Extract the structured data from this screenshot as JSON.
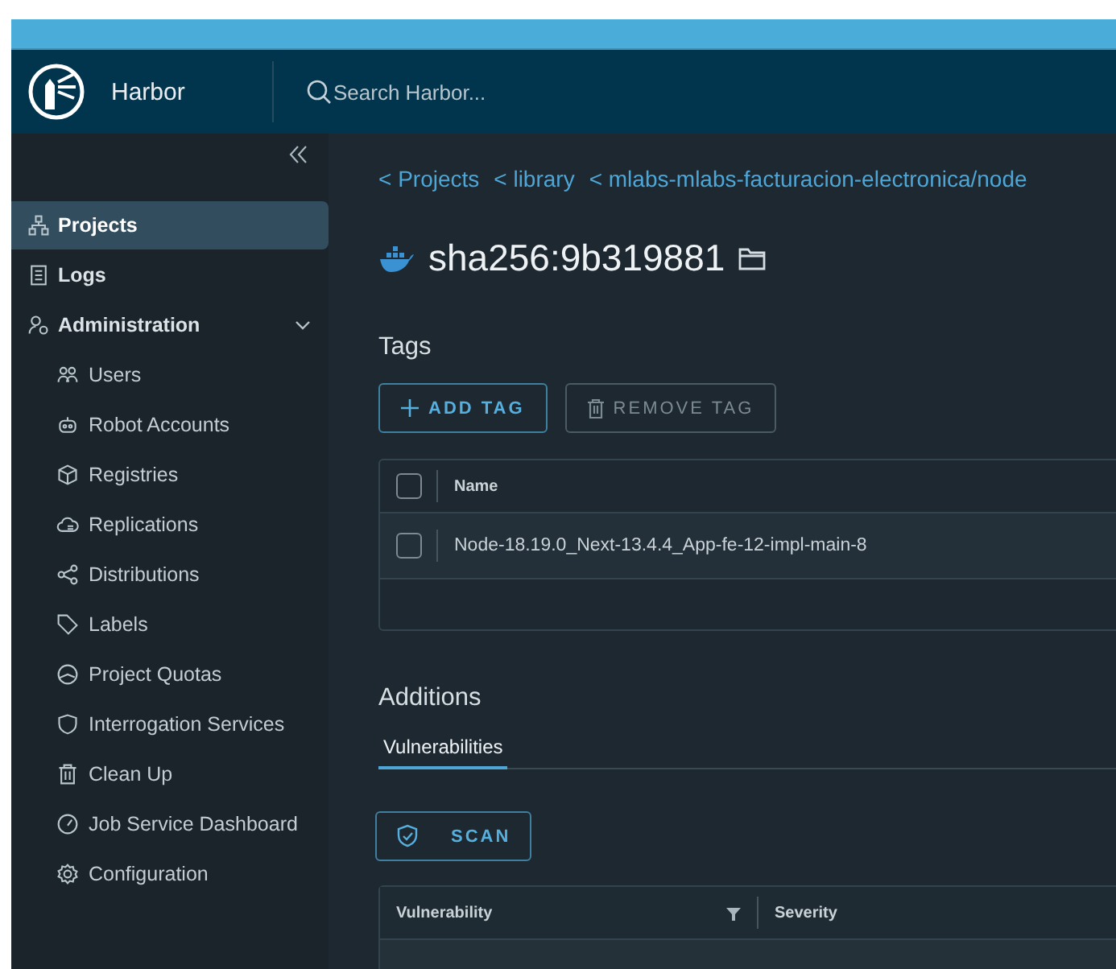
{
  "header": {
    "app_name": "Harbor",
    "search": {
      "placeholder": "Search Harbor..."
    }
  },
  "sidebar": {
    "items": [
      {
        "label": "Projects",
        "selected": true
      },
      {
        "label": "Logs",
        "selected": false
      },
      {
        "label": "Administration",
        "selected": false,
        "expanded": true,
        "children": [
          {
            "label": "Users",
            "selected": false
          },
          {
            "label": "Robot Accounts",
            "selected": false
          },
          {
            "label": "Registries",
            "selected": false
          },
          {
            "label": "Replications",
            "selected": false
          },
          {
            "label": "Distributions",
            "selected": false
          },
          {
            "label": "Labels",
            "selected": false
          },
          {
            "label": "Project Quotas",
            "selected": false
          },
          {
            "label": "Interrogation Services",
            "selected": false
          },
          {
            "label": "Clean Up",
            "selected": false
          },
          {
            "label": "Job Service Dashboard",
            "selected": false
          },
          {
            "label": "Configuration",
            "selected": false
          }
        ]
      }
    ]
  },
  "breadcrumbs": [
    "< Projects",
    "< library",
    "< mlabs-mlabs-facturacion-electronica/node"
  ],
  "artifact": {
    "title": "sha256:9b319881"
  },
  "tags": {
    "heading": "Tags",
    "buttons": [
      {
        "label": "ADD TAG",
        "disabled": false
      },
      {
        "label": "REMOVE TAG",
        "disabled": true
      }
    ],
    "table": {
      "select_all_checked": false,
      "columns": [
        "Name"
      ],
      "rows": [
        {
          "name": "Node-18.19.0_Next-13.4.4_App-fe-12-impl-main-8",
          "checked": false
        }
      ]
    }
  },
  "additions": {
    "heading": "Additions",
    "tabs": [
      {
        "label": "Vulnerabilities",
        "selected": true
      }
    ],
    "scan_button": "SCAN",
    "table": {
      "columns": [
        "Vulnerability",
        "Severity"
      ]
    }
  }
}
